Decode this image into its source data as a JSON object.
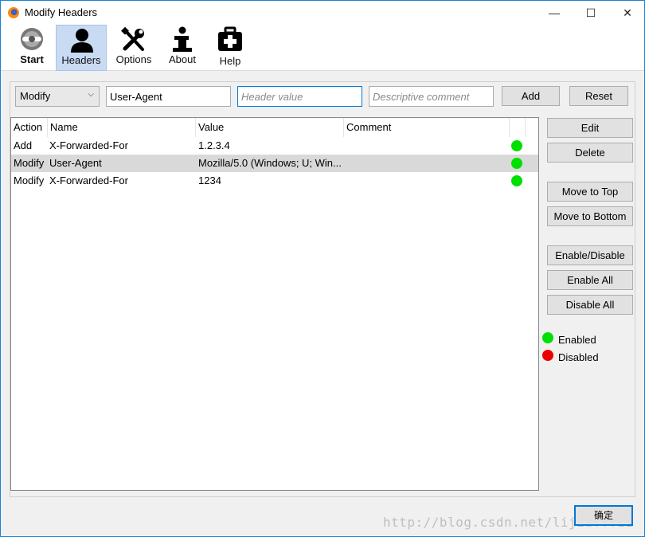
{
  "window": {
    "title": "Modify Headers",
    "controls": {
      "minimize": "—",
      "maximize": "☐",
      "close": "✕"
    }
  },
  "toolbar": {
    "items": [
      {
        "label": "Start",
        "icon": "start-icon"
      },
      {
        "label": "Headers",
        "icon": "user-icon",
        "active": true
      },
      {
        "label": "Options",
        "icon": "wrench-screwdriver-icon"
      },
      {
        "label": "About",
        "icon": "info-icon"
      },
      {
        "label": "Help",
        "icon": "first-aid-kit-icon"
      }
    ]
  },
  "form": {
    "action_value": "Modify",
    "header_name_value": "User-Agent",
    "header_value_placeholder": "Header value",
    "comment_placeholder": "Descriptive comment",
    "add_label": "Add",
    "reset_label": "Reset"
  },
  "table": {
    "columns": [
      "Action",
      "Name",
      "Value",
      "Comment"
    ],
    "rows": [
      {
        "action": "Add",
        "name": "X-Forwarded-For",
        "value": "1.2.3.4",
        "comment": "",
        "enabled": true
      },
      {
        "action": "Modify",
        "name": "User-Agent",
        "value": "Mozilla/5.0 (Windows; U; Win...",
        "comment": "",
        "enabled": true,
        "selected": true
      },
      {
        "action": "Modify",
        "name": "X-Forwarded-For",
        "value": "1234",
        "comment": "",
        "enabled": true
      }
    ]
  },
  "side_buttons": {
    "edit": "Edit",
    "delete": "Delete",
    "move_top": "Move to Top",
    "move_bottom": "Move to Bottom",
    "enable_disable": "Enable/Disable",
    "enable_all": "Enable All",
    "disable_all": "Disable All"
  },
  "legend": {
    "enabled": "Enabled",
    "disabled": "Disabled"
  },
  "ok_label": "确定",
  "watermark": "http://blog.csdn.net/lijia...11",
  "colors": {
    "enabled": "#00e000",
    "disabled": "#ee0000",
    "accent": "#0078d7",
    "active_tab": "#c9daf3"
  }
}
